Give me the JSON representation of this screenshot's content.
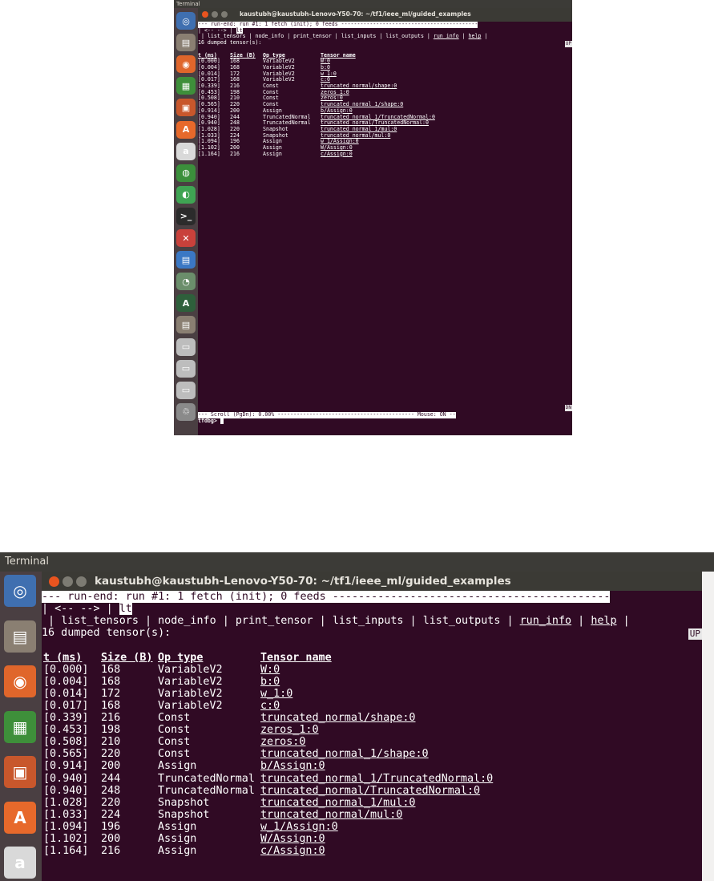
{
  "topbar": {
    "title": "Terminal"
  },
  "window": {
    "title": "kaustubh@kaustubh-Lenovo-Y50-70: ~/tf1/ieee_ml/guided_examples",
    "close_glyph": "×",
    "colors": {
      "close": "#e9541f",
      "minimize": "#7d7b73",
      "maximize": "#7d7b73",
      "terminal_bg": "#300a24"
    }
  },
  "launcher": {
    "items": [
      {
        "icon": "ubuntu-dash-icon",
        "glyph": "◎",
        "color": "#3f6fb0"
      },
      {
        "icon": "files-icon",
        "glyph": "▤",
        "color": "#8a7f72"
      },
      {
        "icon": "firefox-icon",
        "glyph": "◉",
        "color": "#e0662b"
      },
      {
        "icon": "calc-icon",
        "glyph": "▦",
        "color": "#3e8f3a"
      },
      {
        "icon": "impress-icon",
        "glyph": "▣",
        "color": "#c8572c"
      },
      {
        "icon": "software-center-icon",
        "glyph": "A",
        "color": "#e7692b"
      },
      {
        "icon": "amazon-icon",
        "glyph": "a",
        "color": "#d9d9d9"
      },
      {
        "icon": "chrome-icon",
        "glyph": "◍",
        "color": "#3b8f3b"
      },
      {
        "icon": "android-studio-icon",
        "glyph": "◐",
        "color": "#3fa453"
      },
      {
        "icon": "terminal-icon",
        "glyph": ">_",
        "color": "#2b2b2b"
      },
      {
        "icon": "system-settings-icon",
        "glyph": "✕",
        "color": "#c9413b"
      },
      {
        "icon": "writer-icon",
        "glyph": "▤",
        "color": "#3b78c4"
      },
      {
        "icon": "image-viewer-icon",
        "glyph": "◔",
        "color": "#6b8e6b"
      },
      {
        "icon": "updater-icon",
        "glyph": "A",
        "color": "#2e5f3b"
      },
      {
        "icon": "files-2-icon",
        "glyph": "▤",
        "color": "#8a7f72"
      },
      {
        "icon": "drive-1-icon",
        "glyph": "▭",
        "color": "#bdbdbd"
      },
      {
        "icon": "drive-2-icon",
        "glyph": "▭",
        "color": "#bdbdbd"
      },
      {
        "icon": "drive-3-icon",
        "glyph": "▭",
        "color": "#bdbdbd"
      },
      {
        "icon": "trash-icon",
        "glyph": "♲",
        "color": "#8a8a8a"
      }
    ]
  },
  "terminal": {
    "status_line": "--- run-end: run #1: 1 fetch (init); 0 feeds -------------------------------------------",
    "nav_prefix": "| <-- --> | ",
    "nav_cmd": "lt",
    "menu": {
      "sep": " | ",
      "items": [
        "list_tensors",
        "node_info",
        "print_tensor",
        "list_inputs",
        "list_outputs",
        "run_info",
        "help"
      ],
      "end": " |"
    },
    "dumped": "16 dumped tensor(s):",
    "up_btn": "UP",
    "headers": {
      "t": "t (ms)",
      "size": "Size (B)",
      "op": "Op type",
      "name": "Tensor name"
    },
    "rows": [
      {
        "t": "[0.000]",
        "size": "168",
        "op": "VariableV2",
        "name": "W:0"
      },
      {
        "t": "[0.004]",
        "size": "168",
        "op": "VariableV2",
        "name": "b:0"
      },
      {
        "t": "[0.014]",
        "size": "172",
        "op": "VariableV2",
        "name": "w_1:0"
      },
      {
        "t": "[0.017]",
        "size": "168",
        "op": "VariableV2",
        "name": "c:0"
      },
      {
        "t": "[0.339]",
        "size": "216",
        "op": "Const",
        "name": "truncated_normal/shape:0"
      },
      {
        "t": "[0.453]",
        "size": "198",
        "op": "Const",
        "name": "zeros_1:0"
      },
      {
        "t": "[0.508]",
        "size": "210",
        "op": "Const",
        "name": "zeros:0"
      },
      {
        "t": "[0.565]",
        "size": "220",
        "op": "Const",
        "name": "truncated_normal_1/shape:0"
      },
      {
        "t": "[0.914]",
        "size": "200",
        "op": "Assign",
        "name": "b/Assign:0"
      },
      {
        "t": "[0.940]",
        "size": "244",
        "op": "TruncatedNormal",
        "name": "truncated_normal_1/TruncatedNormal:0"
      },
      {
        "t": "[0.940]",
        "size": "248",
        "op": "TruncatedNormal",
        "name": "truncated_normal/TruncatedNormal:0"
      },
      {
        "t": "[1.028]",
        "size": "220",
        "op": "Snapshot",
        "name": "truncated_normal_1/mul:0"
      },
      {
        "t": "[1.033]",
        "size": "224",
        "op": "Snapshot",
        "name": "truncated_normal/mul:0"
      },
      {
        "t": "[1.094]",
        "size": "196",
        "op": "Assign",
        "name": "w_1/Assign:0"
      },
      {
        "t": "[1.102]",
        "size": "200",
        "op": "Assign",
        "name": "W/Assign:0"
      },
      {
        "t": "[1.164]",
        "size": "216",
        "op": "Assign",
        "name": "c/Assign:0"
      }
    ],
    "dn_btn": "DN",
    "scroll_line": "--- Scroll (PgDn): 0.00% ------------------------------------------- Mouse: ON --",
    "prompt": "tfdbg> "
  }
}
